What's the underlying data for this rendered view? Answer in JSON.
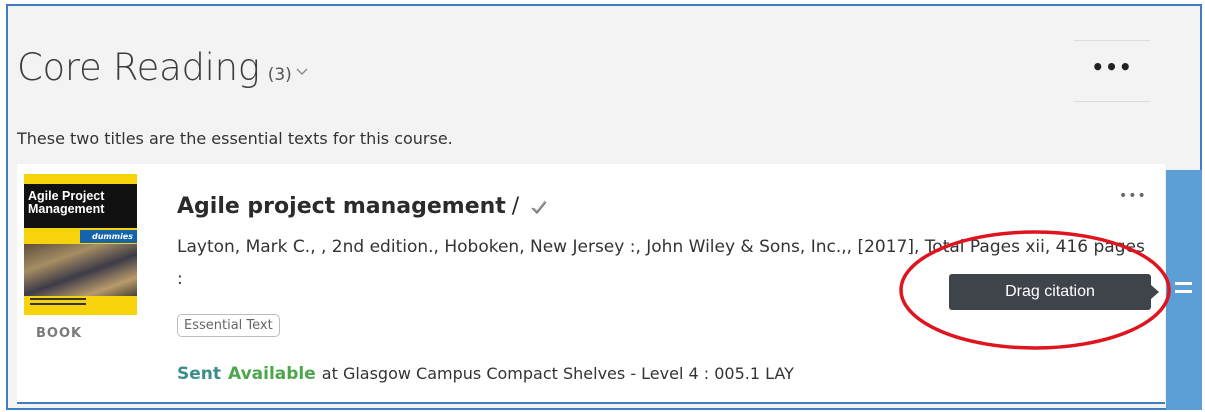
{
  "section": {
    "title": "Core Reading",
    "count": "(3)",
    "description": "These two titles are the essential texts for this course.",
    "more_label": "•••"
  },
  "citation": {
    "title": "Agile project management",
    "title_separator": "/",
    "meta": "Layton, Mark C., , 2nd edition., Hoboken, New Jersey :, John Wiley & Sons, Inc.,, [2017], Total Pages xii, 416 pages :",
    "doc_type": "BOOK",
    "tag": "Essential Text",
    "status_sent": "Sent",
    "status_available": "Available",
    "location": "at Glasgow Campus Compact Shelves - Level 4 : 005.1 LAY",
    "more_label": "•••",
    "cover": {
      "title": "Agile Project Management",
      "brand": "dummies"
    }
  },
  "tooltip": {
    "text": "Drag citation"
  },
  "colors": {
    "accent_blue": "#3f7dbf",
    "drag_handle": "#5b9fd6",
    "sent": "#3c8c8b",
    "available": "#4ca64c",
    "annotation_red": "#e0141e"
  },
  "icons": {
    "chevron": "chevron-down-icon",
    "check": "check-icon",
    "drag": "drag-handle-icon"
  }
}
